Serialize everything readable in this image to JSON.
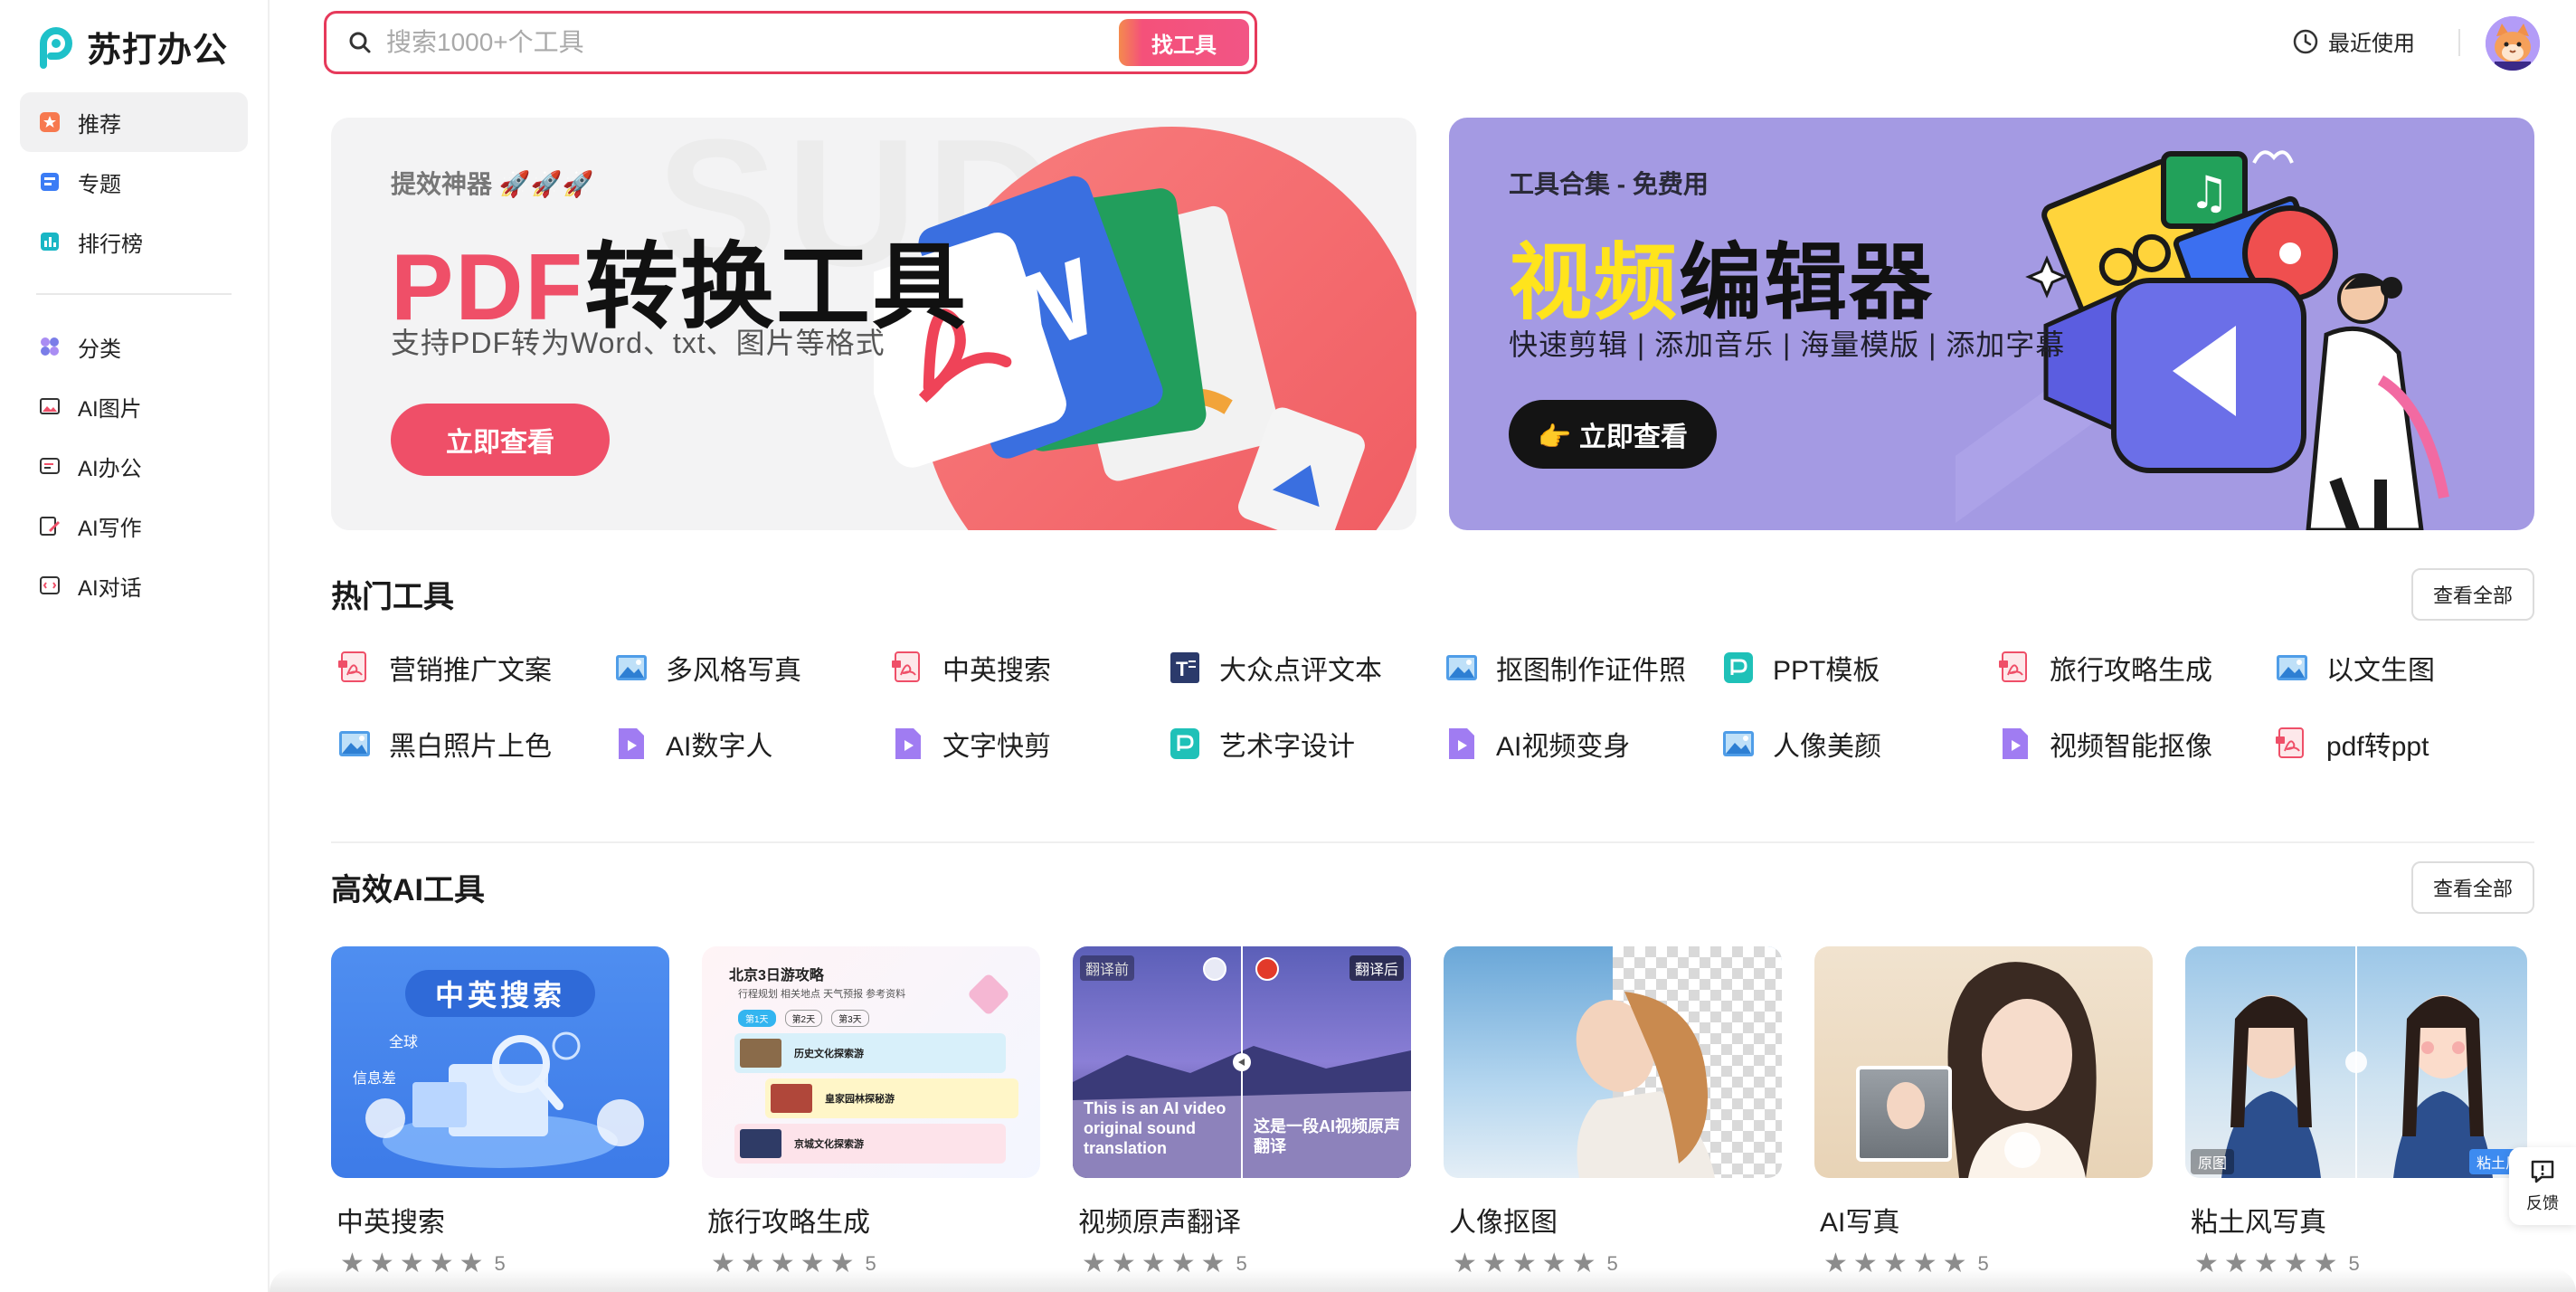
{
  "brand": {
    "name": "苏打办公"
  },
  "sidebar": {
    "items": [
      {
        "label": "推荐",
        "icon": "star-icon",
        "active": true
      },
      {
        "label": "专题",
        "icon": "topic-icon"
      },
      {
        "label": "排行榜",
        "icon": "chart-icon"
      }
    ],
    "items2": [
      {
        "label": "分类",
        "icon": "grid-icon"
      },
      {
        "label": "AI图片",
        "icon": "image-icon"
      },
      {
        "label": "AI办公",
        "icon": "office-icon"
      },
      {
        "label": "AI写作",
        "icon": "write-icon"
      },
      {
        "label": "AI对话",
        "icon": "chat-icon"
      }
    ]
  },
  "search": {
    "placeholder": "搜索1000+个工具",
    "button": "找工具"
  },
  "header": {
    "recent": "最近使用"
  },
  "banners": {
    "pdf": {
      "sub": "提效神器 🚀🚀🚀",
      "title_a": "PDF",
      "title_b": "转换工具",
      "desc": "支持PDF转为Word、txt、图片等格式",
      "button": "立即查看"
    },
    "video": {
      "sub": "工具合集 - 免费用",
      "title_a": "视频",
      "title_b": "编辑器",
      "desc": "快速剪辑 | 添加音乐 | 海量模版 | 添加字幕",
      "button": "👉 立即查看"
    }
  },
  "hot": {
    "title": "热门工具",
    "view_all": "查看全部",
    "tools": [
      {
        "label": "营销推广文案",
        "icon": "pdf"
      },
      {
        "label": "多风格写真",
        "icon": "img"
      },
      {
        "label": "中英搜索",
        "icon": "pdf"
      },
      {
        "label": "大众点评文本",
        "icon": "txt"
      },
      {
        "label": "抠图制作证件照",
        "icon": "img"
      },
      {
        "label": "PPT模板",
        "icon": "ppt"
      },
      {
        "label": "旅行攻略生成",
        "icon": "pdf"
      },
      {
        "label": "以文生图",
        "icon": "img"
      },
      {
        "label": "黑白照片上色",
        "icon": "img"
      },
      {
        "label": "AI数字人",
        "icon": "vid"
      },
      {
        "label": "文字快剪",
        "icon": "vid"
      },
      {
        "label": "艺术字设计",
        "icon": "ppt"
      },
      {
        "label": "AI视频变身",
        "icon": "vid"
      },
      {
        "label": "人像美颜",
        "icon": "img"
      },
      {
        "label": "视频智能抠像",
        "icon": "vid"
      },
      {
        "label": "pdf转ppt",
        "icon": "pdf"
      }
    ]
  },
  "ai": {
    "title": "高效AI工具",
    "view_all": "查看全部",
    "cards": [
      {
        "name": "中英搜索",
        "rating": "5",
        "thumb_title": "中英搜索",
        "tag1": "全球",
        "tag2": "信息差"
      },
      {
        "name": "旅行攻略生成",
        "rating": "5",
        "thumb_title": "北京3日游攻略",
        "tabs": "行程规划 相关地点 天气预报 参考资料",
        "day1": "第1天",
        "day2": "第2天",
        "day3": "第3天",
        "item1": "历史文化探索游",
        "item2": "皇家园林探秘游",
        "item3": "京城文化探索游"
      },
      {
        "name": "视频原声翻译",
        "rating": "5",
        "before": "翻译前",
        "after": "翻译后",
        "text_en": "This is an AI video original sound translation",
        "text_cn": "这是一段AI视频原声翻译"
      },
      {
        "name": "人像抠图",
        "rating": "5"
      },
      {
        "name": "AI写真",
        "rating": "5"
      },
      {
        "name": "粘土风写真",
        "rating": "5",
        "label_left": "原图",
        "label_right": "粘土风"
      }
    ]
  },
  "feedback": {
    "label": "反馈"
  },
  "colors": {
    "accent": "#ef4f68",
    "video_bg": "#a49ae3",
    "yellow": "#ffe41c"
  }
}
